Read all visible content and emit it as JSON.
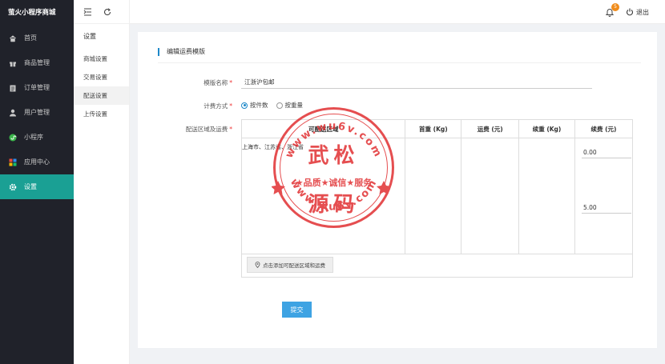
{
  "app": {
    "title": "萤火小程序商城"
  },
  "sidebar": {
    "items": [
      {
        "label": "首页",
        "icon": "home-icon"
      },
      {
        "label": "商品管理",
        "icon": "gift-icon"
      },
      {
        "label": "订单管理",
        "icon": "clipboard-icon"
      },
      {
        "label": "用户管理",
        "icon": "user-icon"
      },
      {
        "label": "小程序",
        "icon": "wechat-icon"
      },
      {
        "label": "应用中心",
        "icon": "apps-icon"
      },
      {
        "label": "设置",
        "icon": "gear-icon",
        "active": true
      }
    ]
  },
  "subnav": {
    "title": "设置",
    "items": [
      "商城设置",
      "交易设置",
      "配送设置",
      "上传设置"
    ],
    "active_index": 2
  },
  "header": {
    "notification_count": "5",
    "logout_label": "退出"
  },
  "form": {
    "section_title": "编辑运费模版",
    "name_label": "模版名称",
    "name_value": "江浙沪包邮",
    "billing_label": "计费方式",
    "billing_options": [
      "按件数",
      "按重量"
    ],
    "billing_selected": 0,
    "region_label": "配送区域及运费",
    "required_mark": "*",
    "table_headers": [
      "可配送区域",
      "首重 (Kg)",
      "运费 (元)",
      "续重 (Kg)",
      "续费 (元)"
    ],
    "region_text": "上海市、江苏省、浙江省",
    "renewal_fee_value": "0.00",
    "fee_value_2": "5.00",
    "add_region_label": "点击添加可配送区域和运费",
    "submit_label": "提交"
  },
  "watermark": {
    "title": "武松",
    "slogan": "★品质★诚信★服务",
    "subtitle": "源码",
    "url": "www.wu6v.com"
  },
  "colors": {
    "sidebar_bg": "#20222a",
    "accent_active": "#1aa094",
    "primary_blue": "#3ea3e3",
    "watermark_red": "#e0282a"
  }
}
